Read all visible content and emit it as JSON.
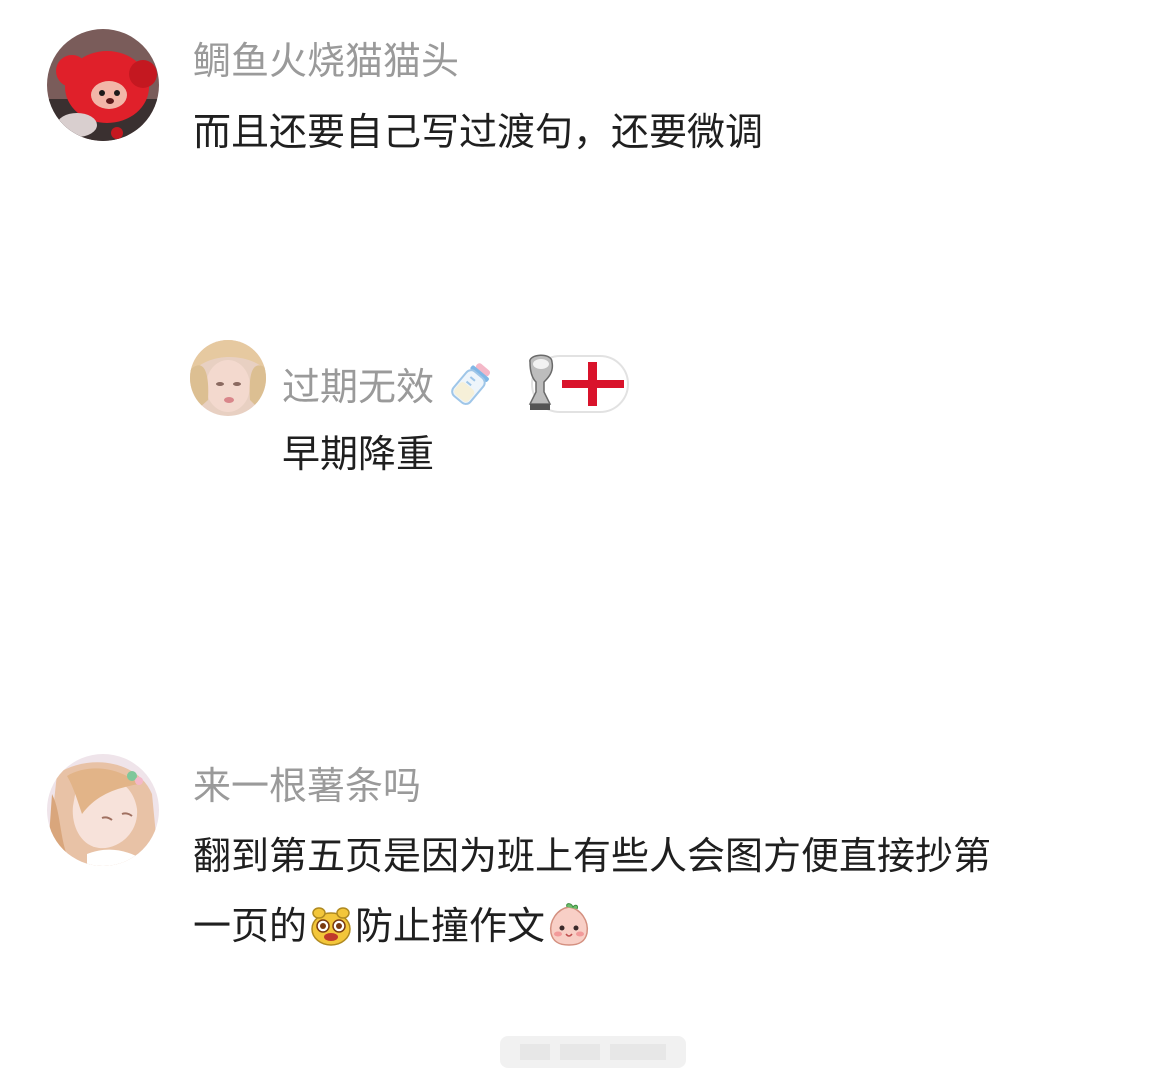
{
  "comments": [
    {
      "username": "鲷鱼火烧猫猫头",
      "text": "而且还要自己写过渡句，还要微调",
      "avatar": "red-plush-avatar"
    },
    {
      "username": "过期无效",
      "badges": [
        "baby-bottle-icon",
        "trophy-icon",
        "england-flag-icon"
      ],
      "text": "早期降重",
      "avatar": "blonde-girl-avatar",
      "is_reply": true
    },
    {
      "username": "来一根薯条吗",
      "text_line1": "翻到第五页是因为班上有些人会图方便直接抄第",
      "text_line2_a": "一页的",
      "text_line2_b": "防止撞作文",
      "avatar": "anime-girl-avatar",
      "emojis": [
        "yellow-dog-face-icon",
        "pink-peach-face-icon"
      ]
    }
  ],
  "colors": {
    "username": "#9a9a9a",
    "text": "#1f1f1f",
    "background": "#ffffff",
    "flag_red": "#d9132b"
  }
}
